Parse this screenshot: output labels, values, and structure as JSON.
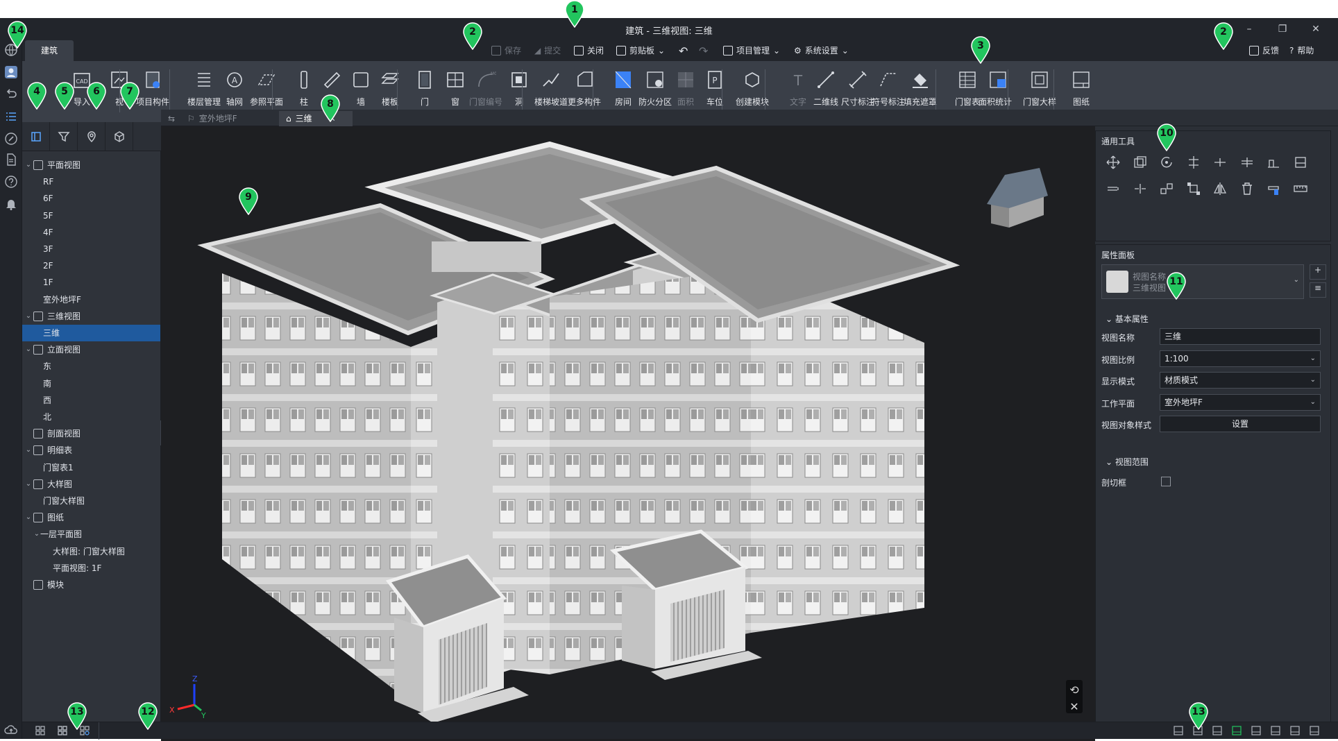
{
  "app": {
    "window_title": "建筑 - 三维视图: 三维",
    "ribbon_tab": "建筑"
  },
  "quick_access": {
    "save": "保存",
    "submit": "提交",
    "close": "关闭",
    "clipboard": "剪贴板",
    "project_mgmt": "项目管理",
    "system_settings": "系统设置",
    "feedback": "反馈",
    "help": "帮助"
  },
  "ribbon": [
    {
      "label": "导入",
      "icon": "cad-import-icon"
    },
    {
      "label": "视",
      "icon": "view-link-icon"
    },
    {
      "label": "项目构件",
      "icon": "project-component-icon"
    },
    {
      "label": "楼层管理",
      "icon": "floor-manage-icon"
    },
    {
      "label": "轴网",
      "icon": "grid-axis-icon"
    },
    {
      "label": "参照平面",
      "icon": "reference-plane-icon"
    },
    {
      "label": "柱",
      "icon": "column-icon"
    },
    {
      "label": "梁",
      "icon": "beam-icon"
    },
    {
      "label": "墙",
      "icon": "wall-icon"
    },
    {
      "label": "楼板",
      "icon": "slab-icon"
    },
    {
      "label": "门",
      "icon": "door-icon"
    },
    {
      "label": "窗",
      "icon": "window-icon"
    },
    {
      "label": "门窗编号",
      "icon": "door-window-number-icon",
      "disabled": true
    },
    {
      "label": "洞",
      "icon": "opening-icon"
    },
    {
      "label": "楼梯坡道",
      "icon": "stair-ramp-icon"
    },
    {
      "label": "更多构件",
      "icon": "more-components-icon"
    },
    {
      "label": "房间",
      "icon": "room-icon"
    },
    {
      "label": "防火分区",
      "icon": "fire-zone-icon"
    },
    {
      "label": "面积",
      "icon": "area-icon",
      "disabled": true
    },
    {
      "label": "车位",
      "icon": "parking-icon"
    },
    {
      "label": "创建模块",
      "icon": "create-module-icon"
    },
    {
      "label": "文字",
      "icon": "text-icon",
      "disabled": true
    },
    {
      "label": "二维线",
      "icon": "2d-line-icon"
    },
    {
      "label": "尺寸标注",
      "icon": "dimension-icon"
    },
    {
      "label": "符号标注",
      "icon": "symbol-annotation-icon"
    },
    {
      "label": "填充遮罩",
      "icon": "fill-mask-icon"
    },
    {
      "label": "门窗表",
      "icon": "door-window-table-icon"
    },
    {
      "label": "面积统计表",
      "icon": "area-stat-table-icon"
    },
    {
      "label": "门窗大样",
      "icon": "door-window-detail-icon"
    },
    {
      "label": "图纸",
      "icon": "sheet-icon"
    }
  ],
  "doc_tabs": [
    {
      "label": "室外地坪F",
      "active": false
    },
    {
      "label": "三维",
      "active": true
    }
  ],
  "tree": [
    {
      "label": "平面视图",
      "level": 0,
      "caret": "v",
      "icon": true
    },
    {
      "label": "RF",
      "level": 1
    },
    {
      "label": "6F",
      "level": 1
    },
    {
      "label": "5F",
      "level": 1
    },
    {
      "label": "4F",
      "level": 1
    },
    {
      "label": "3F",
      "level": 1
    },
    {
      "label": "2F",
      "level": 1
    },
    {
      "label": "1F",
      "level": 1
    },
    {
      "label": "室外地坪F",
      "level": 1
    },
    {
      "label": "三维视图",
      "level": 0,
      "caret": "v",
      "icon": true
    },
    {
      "label": "三维",
      "level": 1,
      "selected": true
    },
    {
      "label": "立面视图",
      "level": 0,
      "caret": "v",
      "icon": true
    },
    {
      "label": "东",
      "level": 1
    },
    {
      "label": "南",
      "level": 1
    },
    {
      "label": "西",
      "level": 1
    },
    {
      "label": "北",
      "level": 1
    },
    {
      "label": "剖面视图",
      "level": 0,
      "caret": "",
      "icon": true
    },
    {
      "label": "明细表",
      "level": 0,
      "caret": "v",
      "icon": true
    },
    {
      "label": "门窗表1",
      "level": 1
    },
    {
      "label": "大样图",
      "level": 0,
      "caret": "v",
      "icon": true
    },
    {
      "label": "门窗大样图",
      "level": 1
    },
    {
      "label": "图纸",
      "level": 0,
      "caret": "v",
      "icon": true
    },
    {
      "label": "一层平面图",
      "level": 1,
      "caret": "v"
    },
    {
      "label": "大样图: 门窗大样图",
      "level": 2
    },
    {
      "label": "平面视图: 1F",
      "level": 2
    },
    {
      "label": "模块",
      "level": 0,
      "caret": "",
      "icon": true
    }
  ],
  "tools_panel": {
    "title": "通用工具"
  },
  "properties": {
    "title": "属性面板",
    "selector_line1": "视图名称",
    "selector_line2": "三维视图",
    "basic_section": "基本属性",
    "fields": [
      {
        "label": "视图名称",
        "value": "三维",
        "type": "text"
      },
      {
        "label": "视图比例",
        "value": "1:100",
        "type": "select"
      },
      {
        "label": "显示模式",
        "value": "材质模式",
        "type": "select"
      },
      {
        "label": "工作平面",
        "value": "室外地坪F",
        "type": "select"
      },
      {
        "label": "视图对象样式",
        "value": "设置",
        "type": "button"
      }
    ],
    "range_section": "视图范围",
    "cut_box_label": "剖切框"
  },
  "axes": {
    "x": "X",
    "y": "Y",
    "z": "Z"
  },
  "markers": [
    "1",
    "2",
    "2",
    "3",
    "4",
    "5",
    "6",
    "7",
    "8",
    "9",
    "10",
    "11",
    "12",
    "13",
    "13",
    "14"
  ],
  "colors": {
    "accent": "#1f5a9e",
    "marker": "#22c55e",
    "background": "#2b2f36",
    "viewport": "#1e1f22"
  }
}
